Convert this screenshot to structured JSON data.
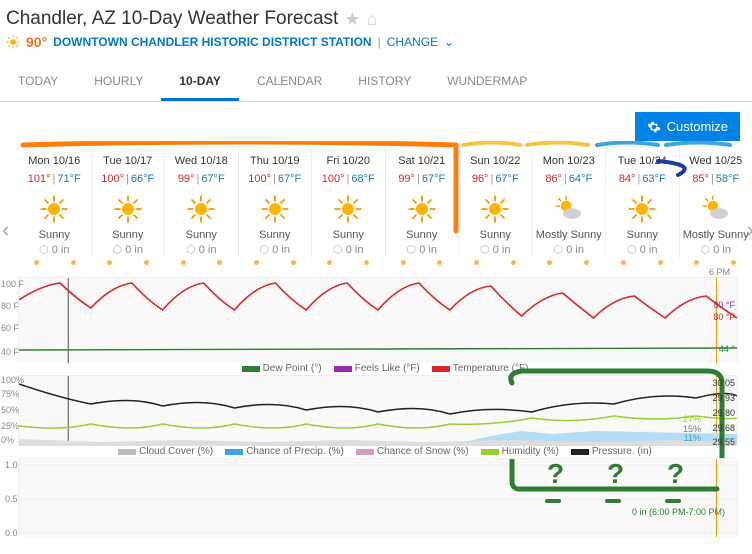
{
  "header": {
    "title": "Chandler, AZ 10-Day Weather Forecast",
    "current_temp": "90°",
    "station": "DOWNTOWN CHANDLER HISTORIC DISTRICT STATION",
    "divider": "|",
    "change": "CHANGE"
  },
  "tabs": [
    {
      "label": "TODAY",
      "active": false
    },
    {
      "label": "HOURLY",
      "active": false
    },
    {
      "label": "10-DAY",
      "active": true
    },
    {
      "label": "CALENDAR",
      "active": false
    },
    {
      "label": "HISTORY",
      "active": false
    },
    {
      "label": "WUNDERMAP",
      "active": false
    }
  ],
  "customize_label": "Customize",
  "days": [
    {
      "name": "Mon 10/16",
      "hi": "101°",
      "lo": "71°F",
      "cond": "Sunny",
      "icon": "sun",
      "precip": "0 in"
    },
    {
      "name": "Tue 10/17",
      "hi": "100°",
      "lo": "66°F",
      "cond": "Sunny",
      "icon": "sun",
      "precip": "0 in"
    },
    {
      "name": "Wed 10/18",
      "hi": "99°",
      "lo": "67°F",
      "cond": "Sunny",
      "icon": "sun",
      "precip": "0 in"
    },
    {
      "name": "Thu 10/19",
      "hi": "100°",
      "lo": "67°F",
      "cond": "Sunny",
      "icon": "sun",
      "precip": "0 in"
    },
    {
      "name": "Fri 10/20",
      "hi": "100°",
      "lo": "68°F",
      "cond": "Sunny",
      "icon": "sun",
      "precip": "0 in"
    },
    {
      "name": "Sat 10/21",
      "hi": "99°",
      "lo": "67°F",
      "cond": "Sunny",
      "icon": "sun",
      "precip": "0 in"
    },
    {
      "name": "Sun 10/22",
      "hi": "96°",
      "lo": "67°F",
      "cond": "Sunny",
      "icon": "sun",
      "precip": "0 in"
    },
    {
      "name": "Mon 10/23",
      "hi": "86°",
      "lo": "64°F",
      "cond": "Mostly Sunny",
      "icon": "mostly",
      "precip": "0 in"
    },
    {
      "name": "Tue 10/24",
      "hi": "84°",
      "lo": "63°F",
      "cond": "Sunny",
      "icon": "sun",
      "precip": "0 in"
    },
    {
      "name": "Wed 10/25",
      "hi": "85°",
      "lo": "58°F",
      "cond": "Mostly Sunny",
      "icon": "mostly",
      "precip": "0 in"
    }
  ],
  "time_marker": "6 PM",
  "chart1_ylabels": [
    "100 F",
    "80 F",
    "60 F",
    "40 F"
  ],
  "chart1_rlabels": [
    {
      "text": "80 °F",
      "color": "#9c27b0"
    },
    {
      "text": "80 °F",
      "color": "#d62728"
    },
    {
      "text": "44 °",
      "color": "#2e7d32"
    }
  ],
  "legend1": [
    {
      "label": "Dew Point (°)",
      "color": "#2e7d32"
    },
    {
      "label": "Feels Like (°F)",
      "color": "#9c27b0"
    },
    {
      "label": "Temperature (°F)",
      "color": "#d62728"
    }
  ],
  "chart2_ylabels": [
    "100%",
    "75%",
    "50%",
    "25%",
    "0%"
  ],
  "chart2_rlabels_left": [],
  "chart2_rlabels": [
    {
      "text": "30.05",
      "color": "#555"
    },
    {
      "text": "29.93",
      "color": "#555"
    },
    {
      "text": "29.80",
      "color": "#555"
    },
    {
      "text": "29.68",
      "color": "#555"
    },
    {
      "text": "29.55",
      "color": "#555"
    }
  ],
  "chart2_annot": [
    {
      "text": "27%",
      "color": "#9acd32"
    },
    {
      "text": "15%",
      "color": "#777"
    },
    {
      "text": "11%",
      "color": "#3aa6dd"
    }
  ],
  "legend2": [
    {
      "label": "Cloud Cover (%)",
      "color": "#bbb"
    },
    {
      "label": "Chance of Precip. (%)",
      "color": "#3aa6dd"
    },
    {
      "label": "Chance of Snow (%)",
      "color": "#d49ac0"
    },
    {
      "label": "Humidity (%)",
      "color": "#9acd32"
    },
    {
      "label": "Pressure. (in)",
      "color": "#222"
    }
  ],
  "chart3_ylabels": [
    "1.0",
    "0.5",
    "0.0"
  ],
  "time_note": "0 in (6:00 PM-7:00 PM)",
  "chart_data": {
    "type": "line",
    "title": "10-Day Weather Forecast Chandler AZ",
    "panels": [
      {
        "name": "temperature",
        "x_days": [
          "10/16",
          "10/17",
          "10/18",
          "10/19",
          "10/20",
          "10/21",
          "10/22",
          "10/23",
          "10/24",
          "10/25"
        ],
        "ylabel": "°F",
        "ylim": [
          40,
          100
        ],
        "series": [
          {
            "name": "Temperature high",
            "values": [
              101,
              100,
              99,
              100,
              100,
              99,
              96,
              86,
              84,
              85
            ]
          },
          {
            "name": "Temperature low",
            "values": [
              71,
              66,
              67,
              67,
              68,
              67,
              67,
              64,
              63,
              58
            ]
          },
          {
            "name": "Dew Point",
            "values": [
              42,
              42,
              43,
              43,
              44,
              44,
              44,
              44,
              44,
              44
            ]
          },
          {
            "name": "Feels Like",
            "values": [
              101,
              100,
              99,
              100,
              100,
              99,
              96,
              86,
              84,
              85
            ]
          }
        ]
      },
      {
        "name": "humidity-pressure",
        "x_days": [
          "10/16",
          "10/17",
          "10/18",
          "10/19",
          "10/20",
          "10/21",
          "10/22",
          "10/23",
          "10/24",
          "10/25"
        ],
        "y_left_label": "%",
        "y_left_lim": [
          0,
          100
        ],
        "y_right_label": "in",
        "y_right_lim": [
          29.55,
          30.05
        ],
        "series": [
          {
            "name": "Humidity",
            "axis": "left",
            "values": [
              22,
              20,
              21,
              22,
              22,
              22,
              23,
              26,
              27,
              27
            ]
          },
          {
            "name": "Cloud Cover",
            "axis": "left",
            "values": [
              5,
              3,
              4,
              6,
              5,
              4,
              6,
              15,
              12,
              15
            ]
          },
          {
            "name": "Chance of Precip",
            "axis": "left",
            "values": [
              0,
              0,
              0,
              0,
              0,
              0,
              3,
              11,
              8,
              11
            ]
          },
          {
            "name": "Chance of Snow",
            "axis": "left",
            "values": [
              0,
              0,
              0,
              0,
              0,
              0,
              0,
              0,
              0,
              0
            ]
          },
          {
            "name": "Pressure",
            "axis": "right",
            "values": [
              29.9,
              29.78,
              29.72,
              29.7,
              29.68,
              29.65,
              29.7,
              29.78,
              29.85,
              29.77
            ]
          }
        ]
      },
      {
        "name": "precipitation",
        "x_days": [
          "10/16",
          "10/17",
          "10/18",
          "10/19",
          "10/20",
          "10/21",
          "10/22",
          "10/23",
          "10/24",
          "10/25"
        ],
        "ylabel": "in",
        "ylim": [
          0,
          1.0
        ],
        "series": [
          {
            "name": "Precip",
            "values": [
              0,
              0,
              0,
              0,
              0,
              0,
              0,
              0,
              0,
              0
            ]
          }
        ]
      }
    ]
  }
}
